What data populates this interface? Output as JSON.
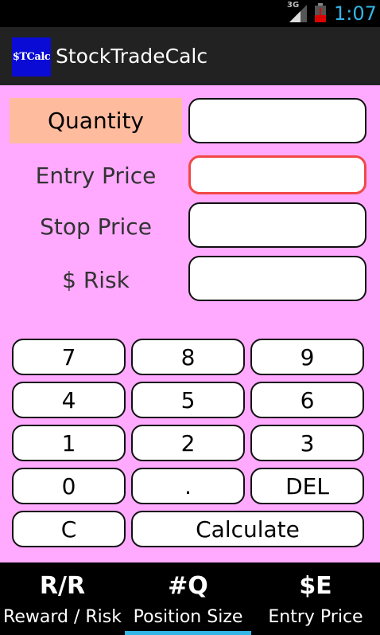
{
  "status_bar": {
    "network": "3G",
    "time": "1:07"
  },
  "app": {
    "icon_text": "$TCalc",
    "title": "StockTradeCalc"
  },
  "form": {
    "quantity_label": "Quantity",
    "entry_price_label": "Entry Price",
    "stop_price_label": "Stop Price",
    "risk_label": "$ Risk",
    "quantity_value": "",
    "entry_price_value": "",
    "stop_price_value": "",
    "risk_value": ""
  },
  "keypad": {
    "k7": "7",
    "k8": "8",
    "k9": "9",
    "k4": "4",
    "k5": "5",
    "k6": "6",
    "k1": "1",
    "k2": "2",
    "k3": "3",
    "k0": "0",
    "dot": ".",
    "del": "DEL",
    "clear": "C",
    "calculate": "Calculate"
  },
  "tabs": [
    {
      "abbr": "R/R",
      "label": "Reward / Risk"
    },
    {
      "abbr": "#Q",
      "label": "Position Size"
    },
    {
      "abbr": "$E",
      "label": "Entry Price"
    }
  ],
  "selected_tab": "Position Size",
  "colors": {
    "content_bg": "#ffaaff",
    "selected_label_bg": "#ffbb9e",
    "focused_border": "#f04848",
    "accent": "#33b5e5",
    "icon_bg": "#0b0bd6"
  }
}
